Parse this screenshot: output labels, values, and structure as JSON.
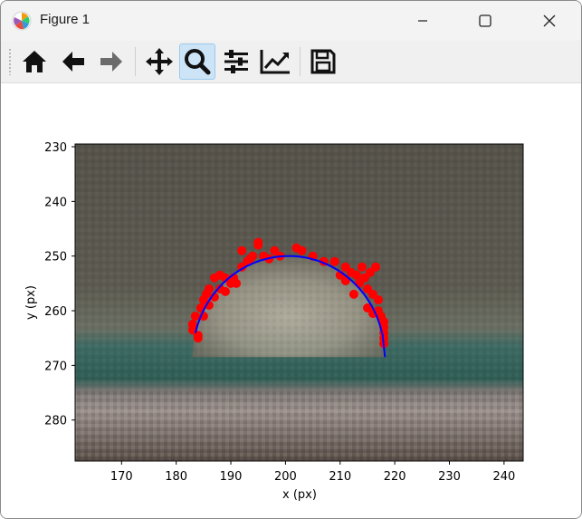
{
  "window": {
    "title": "Figure 1"
  },
  "toolbar": {
    "tools": [
      {
        "name": "home",
        "icon": "home-icon",
        "active": false
      },
      {
        "name": "back",
        "icon": "arrow-left-icon",
        "active": false
      },
      {
        "name": "forward",
        "icon": "arrow-right-icon",
        "active": false,
        "disabled": true
      },
      {
        "name": "pan",
        "icon": "move-icon",
        "active": false
      },
      {
        "name": "zoom",
        "icon": "magnifier-icon",
        "active": true
      },
      {
        "name": "configure-subplots",
        "icon": "sliders-icon",
        "active": false
      },
      {
        "name": "edit-axis",
        "icon": "line-chart-icon",
        "active": false
      },
      {
        "name": "save",
        "icon": "floppy-disk-icon",
        "active": false
      }
    ]
  },
  "chart_data": {
    "type": "scatter",
    "title": "",
    "xlabel": "x (px)",
    "ylabel": "y (px)",
    "xlim": [
      161.5,
      243.5
    ],
    "ylim": [
      287.5,
      229.5
    ],
    "y_inverted": true,
    "xticks": [
      170,
      180,
      190,
      200,
      210,
      220,
      230,
      240
    ],
    "yticks": [
      230,
      240,
      250,
      260,
      270,
      280
    ],
    "background": "droplet image (grayscale/teal pixelated photo)",
    "series": [
      {
        "kind": "scatter",
        "color": "#ff0000",
        "points": [
          [
            183,
            262.5
          ],
          [
            183,
            263.5
          ],
          [
            183.5,
            261
          ],
          [
            184,
            264.5
          ],
          [
            184,
            265
          ],
          [
            184.5,
            259.5
          ],
          [
            185,
            258
          ],
          [
            185,
            261
          ],
          [
            185.5,
            257
          ],
          [
            186,
            256
          ],
          [
            186,
            259
          ],
          [
            187,
            254
          ],
          [
            187,
            257.5
          ],
          [
            188,
            253.5
          ],
          [
            188,
            256
          ],
          [
            189,
            254
          ],
          [
            189,
            256.5
          ],
          [
            190,
            255
          ],
          [
            190.5,
            254
          ],
          [
            191,
            255
          ],
          [
            192,
            249
          ],
          [
            192,
            252
          ],
          [
            193,
            251
          ],
          [
            193.5,
            250.5
          ],
          [
            194,
            250
          ],
          [
            195,
            248
          ],
          [
            195,
            247.5
          ],
          [
            196,
            250
          ],
          [
            197,
            250.5
          ],
          [
            198,
            249
          ],
          [
            199,
            250
          ],
          [
            202,
            248.5
          ],
          [
            203,
            249
          ],
          [
            205,
            250
          ],
          [
            207,
            251
          ],
          [
            209,
            251
          ],
          [
            211,
            252
          ],
          [
            212,
            253
          ],
          [
            213,
            253.5
          ],
          [
            213.5,
            255
          ],
          [
            214,
            252
          ],
          [
            214.5,
            254
          ],
          [
            215,
            256
          ],
          [
            215.5,
            253
          ],
          [
            216,
            257
          ],
          [
            216.5,
            252
          ],
          [
            217,
            258
          ],
          [
            217,
            260
          ],
          [
            217.5,
            261
          ],
          [
            218,
            262
          ],
          [
            218,
            263
          ],
          [
            218,
            264
          ],
          [
            218,
            265
          ],
          [
            218,
            266
          ],
          [
            216,
            260.5
          ],
          [
            215,
            259.5
          ],
          [
            211,
            254.5
          ],
          [
            210,
            253.5
          ],
          [
            212.5,
            257
          ]
        ]
      },
      {
        "kind": "line",
        "color": "#0000ff",
        "name": "",
        "center": [
          200.6,
          268.5
        ],
        "rx": 17.6,
        "ry": 18.5,
        "x_range": [
          183.5,
          218.2
        ]
      }
    ]
  }
}
